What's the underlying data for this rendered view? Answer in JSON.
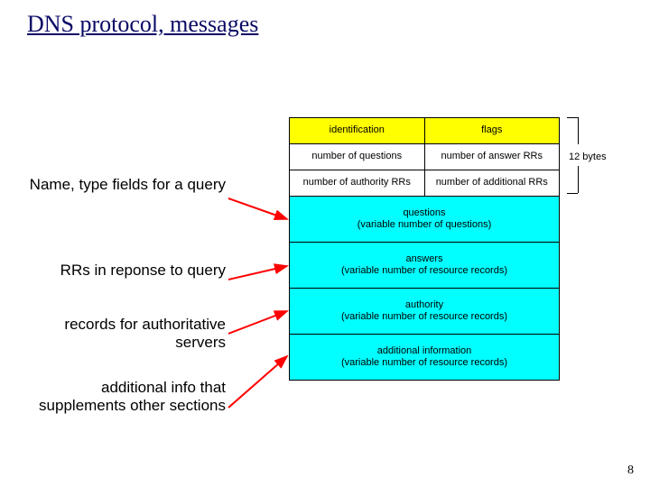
{
  "title": "DNS protocol, messages",
  "labels": {
    "a": "Name, type fields for a query",
    "b": "RRs in reponse to query",
    "c": "records for authoritative servers",
    "d": "additional info that supplements other sections"
  },
  "diagram": {
    "r0_left": "identification",
    "r0_right": "flags",
    "r1_left": "number of questions",
    "r1_right": "number of answer RRs",
    "r2_left": "number of authority RRs",
    "r2_right": "number of additional RRs",
    "r3": "questions\n(variable number of questions)",
    "r4": "answers\n(variable number of resource records)",
    "r5": "authority\n(variable number of resource records)",
    "r6": "additional information\n(variable number of resource records)"
  },
  "bracket_label": "12 bytes",
  "page_number": "8"
}
